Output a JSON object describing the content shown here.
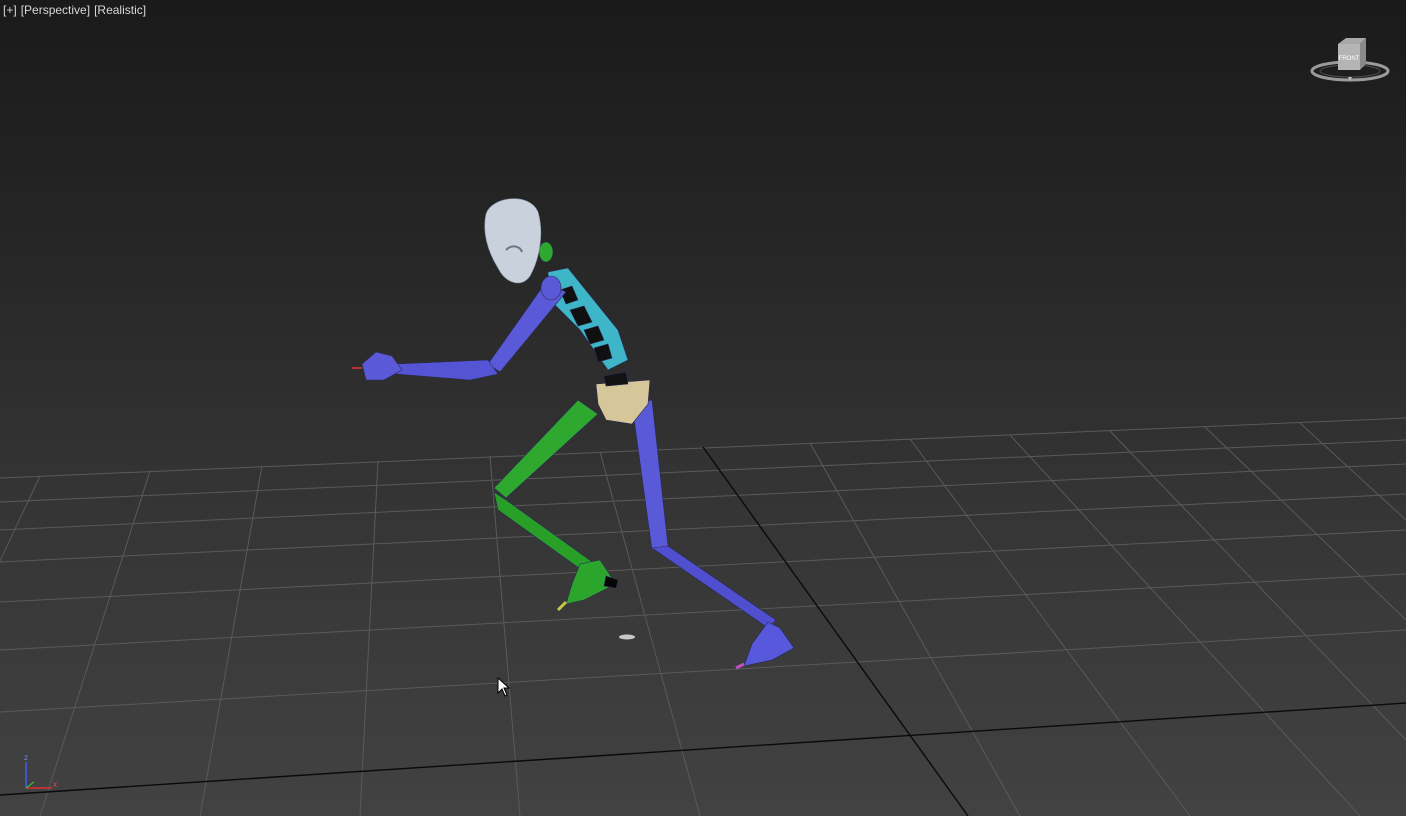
{
  "viewport": {
    "labels": {
      "menu": "[+]",
      "view": "[Perspective]",
      "shading": "[Realistic]"
    },
    "viewcube": {
      "face_label": "FRONT"
    },
    "axis_gizmo": {
      "z": "z",
      "x": "x"
    },
    "icons": [
      "viewcube-icon",
      "axis-gizmo-icon",
      "mouse-pointer-icon"
    ],
    "colors": {
      "biped_blue": "#5a5ad8",
      "biped_green": "#2ea82e",
      "spine_cyan": "#3fb6c8",
      "pelvis_tan": "#d6c79a",
      "head": "#c9d2dc",
      "grid": "#5a5a5a",
      "home_grid_axis": "#0a0a0a"
    }
  }
}
